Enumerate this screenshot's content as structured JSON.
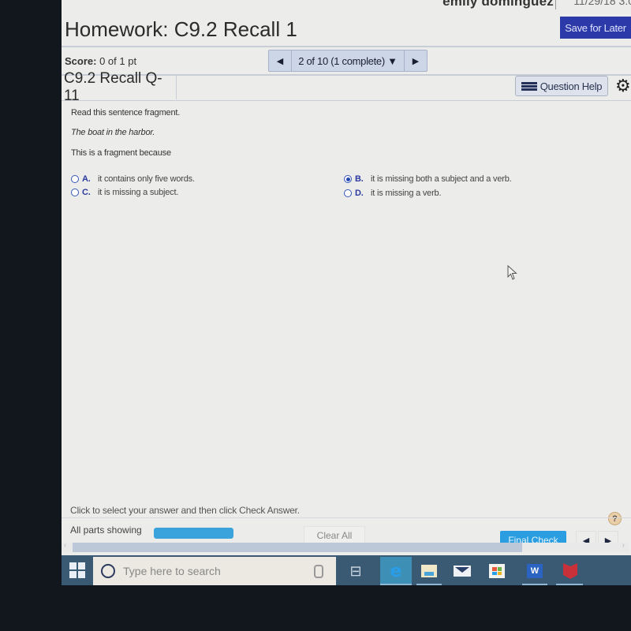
{
  "header": {
    "user_name": "emily dominguez",
    "date_partial": "11/29/18 3:0",
    "title": "Homework: C9.2 Recall 1",
    "save_label": "Save for Later"
  },
  "score": {
    "label": "Score:",
    "value": "0 of 1 pt"
  },
  "question_nav": {
    "prev_icon": "◀",
    "current": "2 of 10 (1 complete) ▼",
    "next_icon": "▶"
  },
  "question": {
    "id": "C9.2 Recall Q-11",
    "help_label": "Question Help",
    "instruction": "Read this sentence fragment.",
    "fragment": "The boat in the harbor.",
    "prompt": "This is a fragment because",
    "choices": [
      {
        "letter": "A.",
        "text": "it contains only five words.",
        "selected": false
      },
      {
        "letter": "B.",
        "text": "it is missing both a subject and a verb.",
        "selected": true
      },
      {
        "letter": "C.",
        "text": "it is missing a subject.",
        "selected": false
      },
      {
        "letter": "D.",
        "text": "it is missing a verb.",
        "selected": false
      }
    ]
  },
  "footer": {
    "hint": "Click to select your answer and then click Check Answer.",
    "parts_label": "All parts showing",
    "progress_percent": 100,
    "clear_all_label": "Clear All",
    "final_check_label": "Final Check",
    "help_icon": "?",
    "prev_icon": "◀",
    "next_icon": "▶"
  },
  "taskbar": {
    "search_placeholder": "Type here to search",
    "apps": [
      "task-view",
      "edge",
      "file-explorer",
      "mail",
      "store",
      "word",
      "mcafee"
    ]
  },
  "colors": {
    "save_button": "#2b3aa8",
    "final_check": "#2a9ee0",
    "progress_fill": "#3aa3dc",
    "choice_letter": "#2b3a9e",
    "taskbar": "#3a5a74"
  }
}
